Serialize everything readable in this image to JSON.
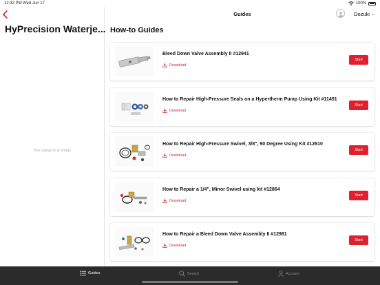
{
  "status_bar": {
    "time": "12:32 PM",
    "date": "Wed Jun 17",
    "battery": "100%"
  },
  "sidebar": {
    "title": "HyPrecision Waterje...",
    "empty_message": "This category is empty."
  },
  "topnav": {
    "title": "Guides",
    "brand": "Dozuki"
  },
  "main": {
    "section_title": "How-to Guides",
    "download_label": "Download",
    "start_label": "Start",
    "guides": [
      {
        "title": "Bleed Down Valve Assembly II #12941"
      },
      {
        "title": "How to Repair High-Pressure Seals on a Hypertherm Pump Using Kit #11451"
      },
      {
        "title": "How to Repair High-Pressure Swivel, 3/8\", 90 Degree Using Kit #12610"
      },
      {
        "title": "How to Repair a 1/4\", Minor Swivel using kit #12864"
      },
      {
        "title": "How to Repair a Bleed Down Valve Assembly II #12981"
      }
    ]
  },
  "tabs": {
    "guides": "Guides",
    "search": "Search",
    "account": "Account"
  },
  "colors": {
    "accent": "#e0202c",
    "tabbar": "#2b2b2b"
  }
}
